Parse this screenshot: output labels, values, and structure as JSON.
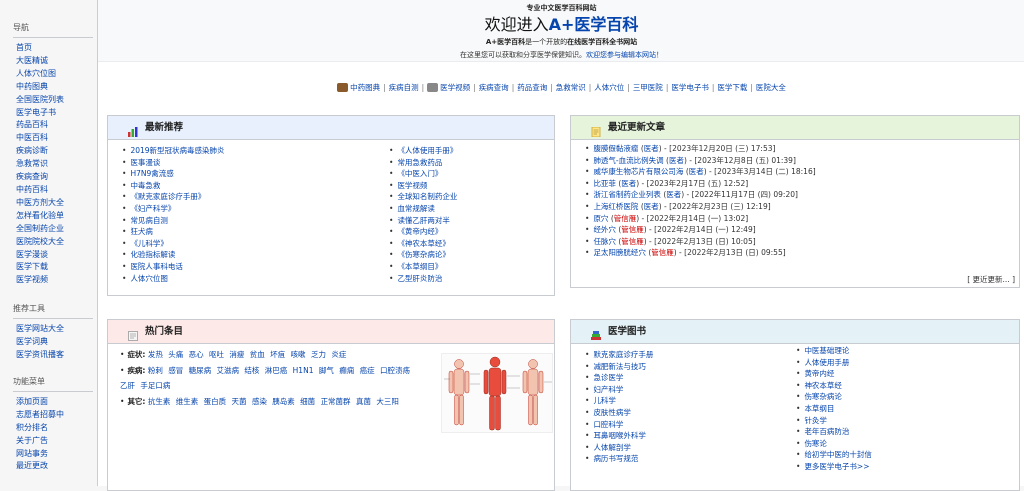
{
  "sidebar": {
    "nav_title": "导航",
    "nav_items": [
      "首页",
      "大医精诚",
      "人体穴位图",
      "中药图典",
      "全国医院列表",
      "医学电子书",
      "药品百科",
      "中医百科",
      "疾病诊断",
      "急救常识",
      "疾病查询",
      "中药百科",
      "中医方剂大全",
      "怎样看化验单",
      "全国制药企业",
      "医院院校大全",
      "医学漫谈",
      "医学下载",
      "医学视频"
    ],
    "tools_title": "推荐工具",
    "tools_items": [
      "医学网站大全",
      "医学词典",
      "医学资讯播客"
    ],
    "func_title": "功能菜单",
    "func_items": [
      "添加页面",
      "志愿者招募中",
      "积分排名",
      "关于广告",
      "网站事务",
      "最近更改"
    ]
  },
  "banner": {
    "kicker": "专业中文医学百科网站",
    "title_prefix": "欢迎进入",
    "title_brand": "A+医学百科",
    "desc_a": "A+医学百科",
    "desc_b": "是一个开放的",
    "desc_c": "在线医学百科全书网站",
    "hint_text": "在这里您可以获取和分享医学保健知识。",
    "hint_link": "欢迎您参与编辑本网站！"
  },
  "topnav": [
    "中药图典",
    "疾病自测",
    "医学视频",
    "疾病查询",
    "药品查询",
    "急救常识",
    "人体穴位",
    "三甲医院",
    "医学电子书",
    "医学下载",
    "医院大全"
  ],
  "colors": {
    "blue_head": "#e8f0fe",
    "green_head": "#e6f4dc",
    "red_head": "#fde9e7",
    "cyan_head": "#e4f1f6",
    "link": "#0645ad"
  },
  "recommend": {
    "title": "最新推荐",
    "left": [
      "2019新型冠状病毒感染肺炎",
      "医事漫谈",
      "H7N9禽流感",
      "中毒急救",
      "《默克家庭诊疗手册》",
      "《妇产科学》",
      "常见病自测",
      "狂犬病",
      "《儿科学》",
      "化验指标解读",
      "医院人事科电话",
      "人体穴位图"
    ],
    "right": [
      "《人体使用手册》",
      "常用急救药品",
      "《中医入门》",
      "医学视频",
      "全球知名制药企业",
      "血常规解读",
      "读懂乙肝两对半",
      "《黄帝内经》",
      "《神农本草经》",
      "《伤寒杂病论》",
      "《本草纲目》",
      "乙型肝炎防治"
    ]
  },
  "recent": {
    "title": "最近更新文章",
    "items": [
      {
        "name": "腹膜假黏液瘤",
        "tag": "医者",
        "date": "2023年12月20日 (三) 17:53",
        "red": false
      },
      {
        "name": "肺透气-血流比例失调",
        "tag": "医者",
        "date": "2023年12月8日 (五) 01:39",
        "red": false
      },
      {
        "name": "威华康生物芯片有限公司海",
        "tag": "医者",
        "date": "2023年3月14日 (二) 18:16",
        "red": false
      },
      {
        "name": "比亚菲",
        "tag": "医者",
        "date": "2023年2月17日 (五) 12:52",
        "red": false
      },
      {
        "name": "浙江省制药企业列表",
        "tag": "医者",
        "date": "2022年11月17日 (四) 09:20",
        "red": false
      },
      {
        "name": "上海红桥医院",
        "tag": "医者",
        "date": "2022年2月23日 (三) 12:19",
        "red": false
      },
      {
        "name": "原穴",
        "tag": "管信雁",
        "date": "2022年2月14日 (一) 13:02",
        "red": true
      },
      {
        "name": "经外穴",
        "tag": "管信雁",
        "date": "2022年2月14日 (一) 12:49",
        "red": true
      },
      {
        "name": "任脉穴",
        "tag": "管信雁",
        "date": "2022年2月13日 (日) 10:05",
        "red": true
      },
      {
        "name": "足太阳膀胱经穴",
        "tag": "管信雁",
        "date": "2022年2月13日 (日) 09:55",
        "red": true
      }
    ],
    "more": "[ 更近更新... ]"
  },
  "hot": {
    "title": "热门条目",
    "groups": [
      {
        "label": "症状:",
        "items": [
          "发热",
          "头痛",
          "恶心",
          "呕吐",
          "消瘦",
          "贫血",
          "坏疽",
          "咳嗽",
          "乏力",
          "炎症"
        ]
      },
      {
        "label": "疾病:",
        "items": [
          "粉刺",
          "感冒",
          "糖尿病",
          "艾滋病",
          "结核",
          "淋巴癌",
          "H1N1",
          "脚气",
          "癫痫",
          "癌症",
          "口腔溃疡",
          "乙肝",
          "手足口病"
        ]
      },
      {
        "label": "其它:",
        "items": [
          "抗生素",
          "维生素",
          "蛋白质",
          "天菌",
          "感染",
          "胰岛素",
          "细菌",
          "正常菌群",
          "真菌",
          "大三阳"
        ]
      }
    ]
  },
  "books": {
    "title": "医学图书",
    "left": [
      "默克家庭诊疗手册",
      "减肥新法与技巧",
      "急诊医学",
      "妇产科学",
      "儿科学",
      "皮肤性病学",
      "口腔科学",
      "耳鼻咽喉外科学",
      "人体解剖学",
      "病历书写规范"
    ],
    "right": [
      "中医基础理论",
      "人体使用手册",
      "黄帝内经",
      "神农本草经",
      "伤寒杂病论",
      "本草纲目",
      "针灸学",
      "老年百病防治",
      "伤寒论",
      "给初学中医的十封信",
      "更多医学电子书>>"
    ]
  }
}
